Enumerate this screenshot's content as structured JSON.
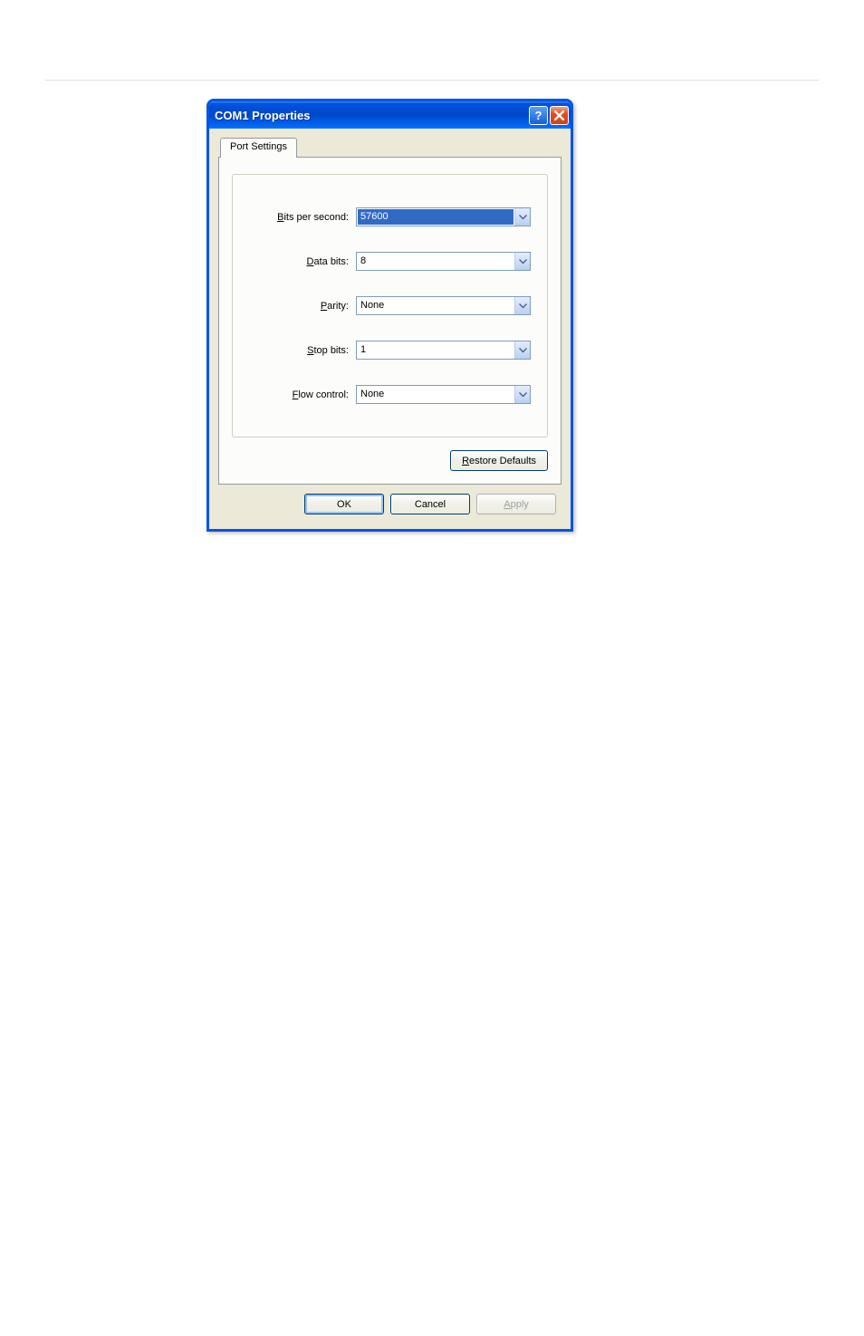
{
  "dialog": {
    "title": "COM1 Properties",
    "tab_label": "Port Settings",
    "fields": {
      "bits_per_second": {
        "label_pre": "B",
        "label_post": "its per second:",
        "value": "57600"
      },
      "data_bits": {
        "label_pre": "D",
        "label_post": "ata bits:",
        "value": "8"
      },
      "parity": {
        "label_pre": "P",
        "label_post": "arity:",
        "value": "None"
      },
      "stop_bits": {
        "label_pre": "S",
        "label_post": "top bits:",
        "value": "1"
      },
      "flow_control": {
        "label_pre": "F",
        "label_post": "low control:",
        "value": "None"
      }
    },
    "buttons": {
      "restore_pre": "R",
      "restore_post": "estore Defaults",
      "ok": "OK",
      "cancel": "Cancel",
      "apply_pre": "A",
      "apply_post": "pply"
    }
  }
}
